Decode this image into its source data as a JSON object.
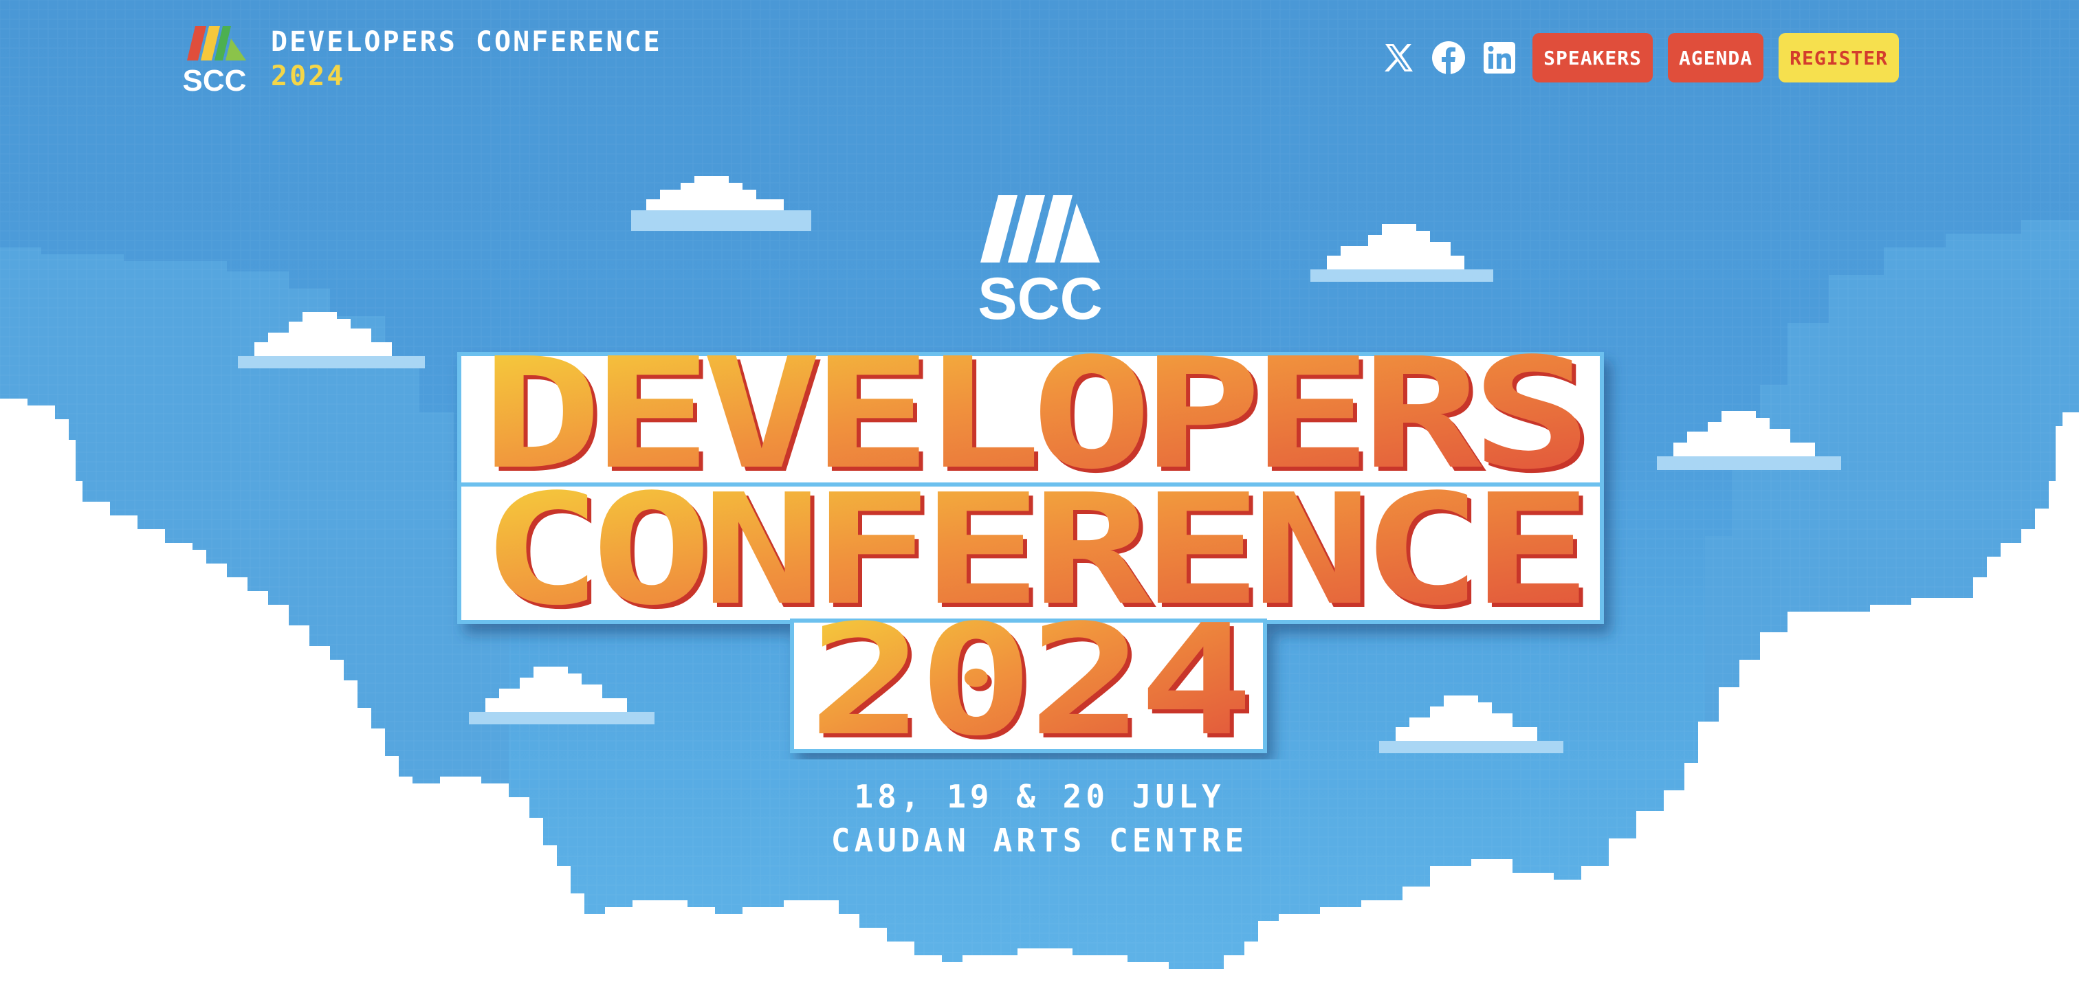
{
  "brand": {
    "logo_text": "SCC",
    "title": "DEVELOPERS CONFERENCE",
    "year": "2024"
  },
  "nav": {
    "social": [
      {
        "icon": "x-twitter-icon"
      },
      {
        "icon": "facebook-icon"
      },
      {
        "icon": "linkedin-icon"
      }
    ],
    "buttons": {
      "speakers": "SPEAKERS",
      "agenda": "AGENDA",
      "register": "REGISTER"
    }
  },
  "hero": {
    "logo_text": "SCC",
    "title_line1": "DEVELOPERS",
    "title_line2": "CONFERENCE",
    "title_line3": "2024",
    "dates": "18, 19 & 20 JULY",
    "venue": "CAUDAN ARTS CENTRE"
  },
  "colors": {
    "sky": "#4d9ddb",
    "title_yellow": "#f6d43c",
    "title_orange": "#f0913d",
    "title_red": "#e04e3b",
    "button_red": "#e04e3b",
    "button_yellow": "#f6e04e",
    "year_yellow": "#f4d648"
  }
}
